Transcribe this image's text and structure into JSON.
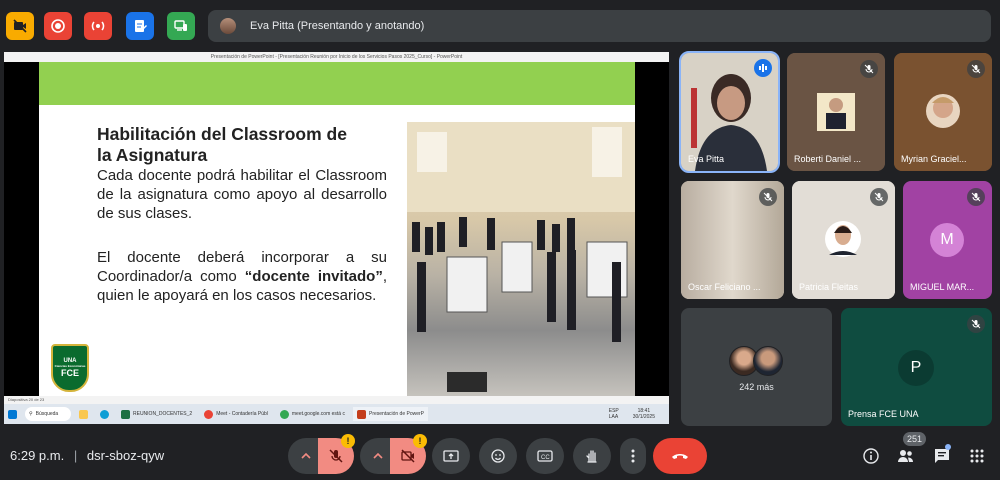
{
  "top_bar": {
    "presenter_label": "Eva Pitta (Presentando y anotando)"
  },
  "shared_screen": {
    "window_title": "Presentación de PowerPoint - [Presentación Reunión por Inicio de los Servicios Pasos 2025_Curso] - PowerPoint",
    "slide": {
      "heading_line1": "Habilitación del Classroom de",
      "heading_line2": "la Asignatura",
      "paragraph1": "Cada docente podrá habilitar el Classroom de la asignatura como apoyo al desarrollo de sus clases.",
      "paragraph2_part1": "El docente deberá incorporar a su Coordinador/a como ",
      "paragraph2_bold": "“docente invitado”",
      "paragraph2_part2": ", quien le apoyará en los casos necesarios.",
      "logo_top": "UNA",
      "logo_mid": "Ciencias Económicas",
      "logo_bottom": "FCE"
    },
    "status_bar_text": "Diapositiva 20 de 23",
    "taskbar": {
      "search": "Búsqueda",
      "items": [
        "REUNION_DOCENTES_2",
        "Meet - Contadería Públ",
        "meet.google.com está c",
        "Presentación de PowerP"
      ],
      "lang": "ESP LAA",
      "time": "18:41",
      "date": "30/1/2025"
    }
  },
  "participants": [
    {
      "name": "Eva Pitta"
    },
    {
      "name": "Roberti Daniel ..."
    },
    {
      "name": "Myrian Graciel..."
    },
    {
      "name": "Oscar Feliciano ..."
    },
    {
      "name": "Patricia Fleitas"
    },
    {
      "name": "MIGUEL MAR...",
      "initial": "M"
    },
    {
      "name": "242 más"
    },
    {
      "name": "Prensa FCE UNA",
      "initial": "P"
    }
  ],
  "bottom_bar": {
    "time": "6:29 p.m.",
    "separator": "|",
    "meeting_code": "dsr-sboz-qyw",
    "participant_count": "251",
    "warning_mark": "!"
  },
  "colors": {
    "background": "#202124",
    "tile": "#3c4043",
    "accent_blue": "#8ab4f8",
    "end_call": "#ea4335",
    "muted_warn": "#f28b82",
    "slide_green": "#92d050",
    "prensa_tile": "#0f4c40",
    "miguel_tile": "#a142a3"
  }
}
